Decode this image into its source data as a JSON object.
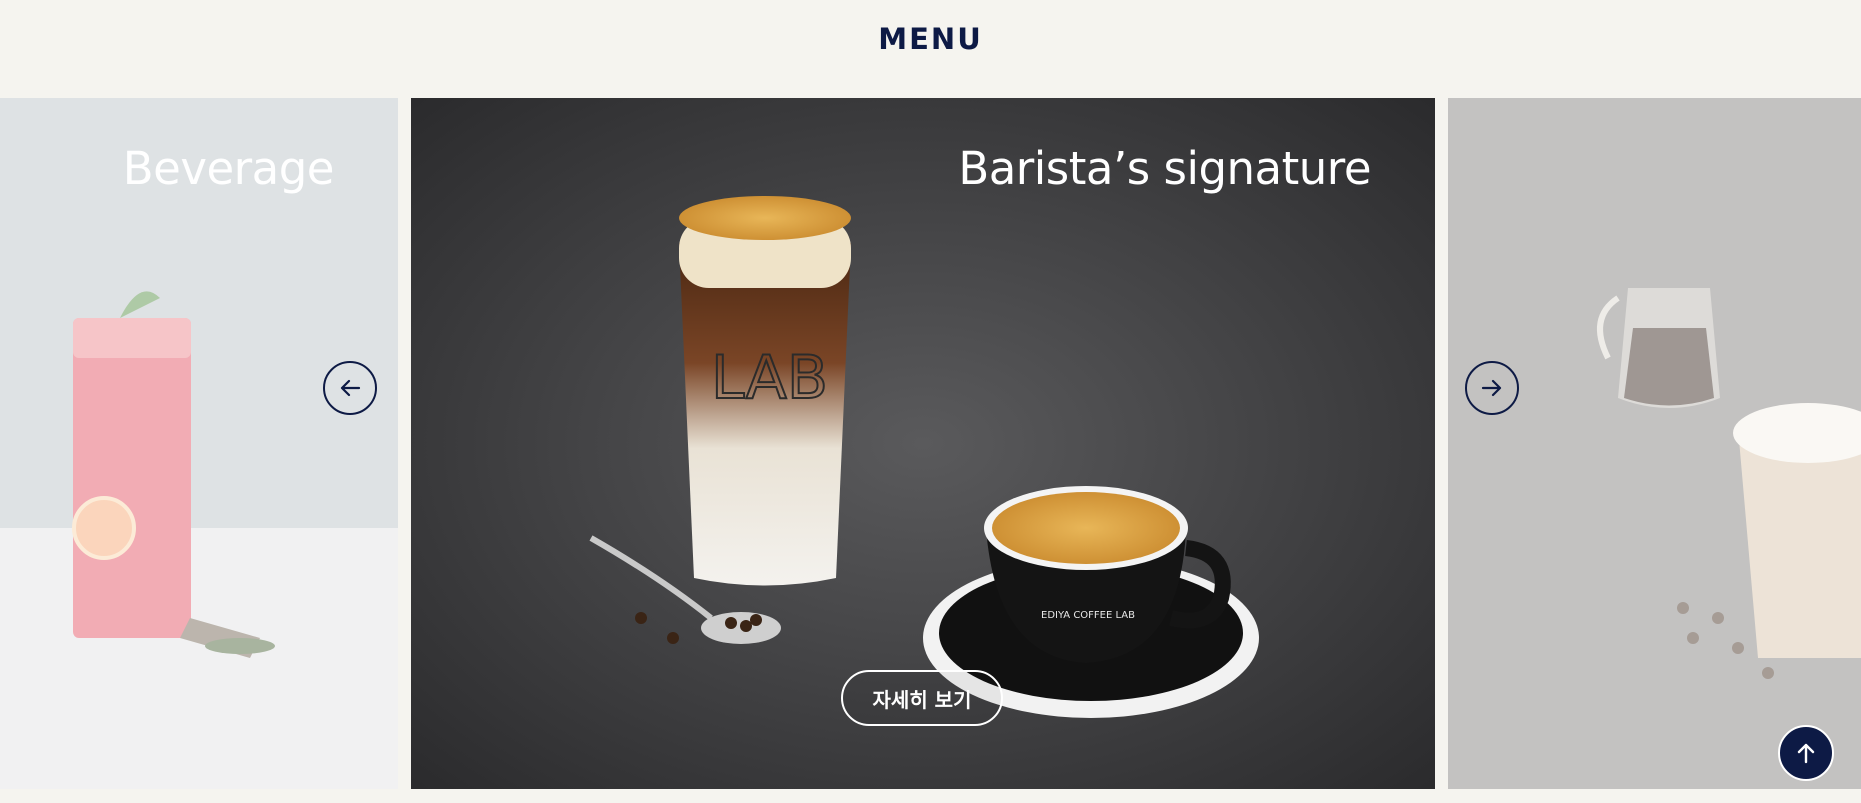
{
  "section": {
    "title": "MENU"
  },
  "slides": [
    {
      "title": "Beverage"
    },
    {
      "title": "Barista’s signature",
      "cta_label": "자세히 보기"
    },
    {
      "title": ""
    }
  ],
  "colors": {
    "navy": "#0d1a45",
    "background": "#f5f4ef"
  },
  "icons": {
    "prev": "arrow-left-icon",
    "next": "arrow-right-icon",
    "top": "arrow-up-icon"
  }
}
